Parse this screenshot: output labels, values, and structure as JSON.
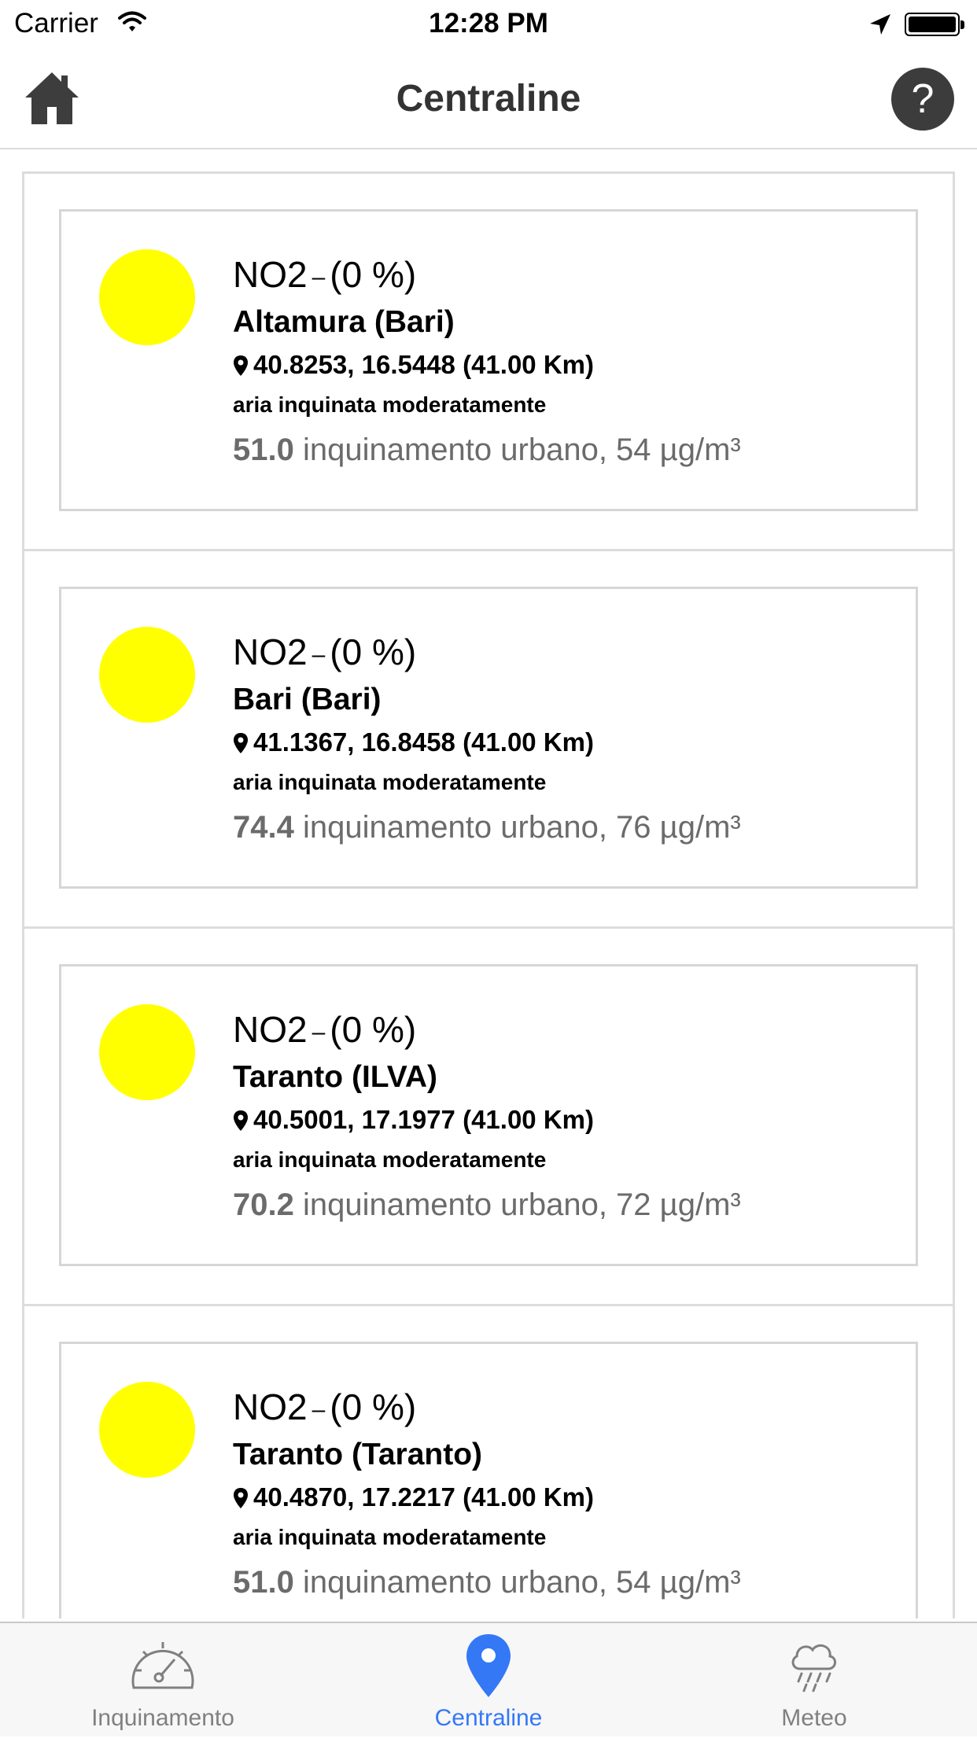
{
  "status_bar": {
    "carrier": "Carrier",
    "time": "12:28 PM"
  },
  "header": {
    "title": "Centraline"
  },
  "help_label": "?",
  "stations": [
    {
      "pollutant": "NO2",
      "percent": "(0 %)",
      "name": "Altamura (Bari)",
      "coords": "40.8253, 16.5448 (41.00 Km)",
      "quality": "aria inquinata moderatamente",
      "index": "51.0",
      "detail": "inquinamento urbano, 54 µg/m³",
      "color": "#ffff00"
    },
    {
      "pollutant": "NO2",
      "percent": "(0 %)",
      "name": "Bari (Bari)",
      "coords": "41.1367, 16.8458 (41.00 Km)",
      "quality": "aria inquinata moderatamente",
      "index": "74.4",
      "detail": "inquinamento urbano, 76 µg/m³",
      "color": "#ffff00"
    },
    {
      "pollutant": "NO2",
      "percent": "(0 %)",
      "name": "Taranto (ILVA)",
      "coords": "40.5001, 17.1977 (41.00 Km)",
      "quality": "aria inquinata moderatamente",
      "index": "70.2",
      "detail": "inquinamento urbano, 72 µg/m³",
      "color": "#ffff00"
    },
    {
      "pollutant": "NO2",
      "percent": "(0 %)",
      "name": "Taranto (Taranto)",
      "coords": "40.4870, 17.2217 (41.00 Km)",
      "quality": "aria inquinata moderatamente",
      "index": "51.0",
      "detail": "inquinamento urbano, 54 µg/m³",
      "color": "#ffff00"
    }
  ],
  "tabs": [
    {
      "label": "Inquinamento",
      "icon": "gauge-icon",
      "active": false
    },
    {
      "label": "Centraline",
      "icon": "map-pin-icon",
      "active": true
    },
    {
      "label": "Meteo",
      "icon": "rain-cloud-icon",
      "active": false
    }
  ],
  "colors": {
    "accent": "#3478f6",
    "indicator": "#ffff00"
  }
}
